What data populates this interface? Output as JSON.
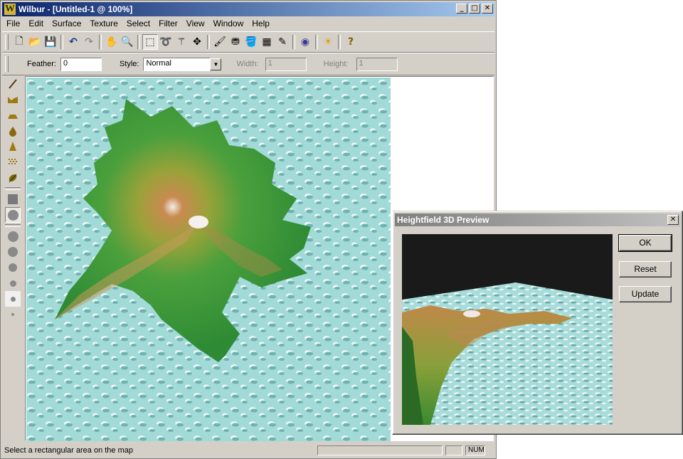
{
  "window": {
    "title": "Wilbur - [Untitled-1 @ 100%]",
    "logo_letter": "W",
    "controls": {
      "minimize": "_",
      "maximize": "□",
      "close": "✕"
    }
  },
  "menu": [
    "File",
    "Edit",
    "Surface",
    "Texture",
    "Select",
    "Filter",
    "View",
    "Window",
    "Help"
  ],
  "toolbar": {
    "tools": [
      {
        "name": "new-icon",
        "glyph": "🗋"
      },
      {
        "name": "open-icon",
        "glyph": "📂"
      },
      {
        "name": "save-icon",
        "glyph": "💾"
      },
      {
        "name": "undo-icon",
        "glyph": "↶"
      },
      {
        "name": "redo-icon",
        "glyph": "↷"
      },
      {
        "name": "hand-icon",
        "glyph": "✋"
      },
      {
        "name": "zoom-icon",
        "glyph": "🔍"
      },
      {
        "name": "rect-select-icon",
        "glyph": "⬚"
      },
      {
        "name": "lasso-icon",
        "glyph": "➰"
      },
      {
        "name": "magic-wand-icon",
        "glyph": "⚚"
      },
      {
        "name": "move-icon",
        "glyph": "✥"
      },
      {
        "name": "brush-icon",
        "glyph": "🖌"
      },
      {
        "name": "stamp-icon",
        "glyph": "⛃"
      },
      {
        "name": "fill-icon",
        "glyph": "🪣"
      },
      {
        "name": "gradient-icon",
        "glyph": "▦"
      },
      {
        "name": "pencil-icon",
        "glyph": "✎"
      },
      {
        "name": "render-icon",
        "glyph": "◉"
      },
      {
        "name": "light-icon",
        "glyph": "☀"
      },
      {
        "name": "help-icon",
        "glyph": "?"
      }
    ]
  },
  "options": {
    "feather_label": "Feather:",
    "feather_value": "0",
    "style_label": "Style:",
    "style_value": "Normal",
    "width_label": "Width:",
    "width_value": "1",
    "height_label": "Height:",
    "height_value": "1"
  },
  "status": {
    "message": "Select a rectangular area on the map",
    "num": "NUM"
  },
  "dialog": {
    "title": "Heightfield 3D Preview",
    "ok": "OK",
    "reset": "Reset",
    "update": "Update",
    "close": "✕"
  },
  "colors": {
    "water": "#9fd8d6",
    "land_low": "#3f9a3a",
    "land_mid": "#c08a3a",
    "peak": "#f2ece8",
    "title_active": "#0a246a",
    "title_inactive": "#808080"
  }
}
